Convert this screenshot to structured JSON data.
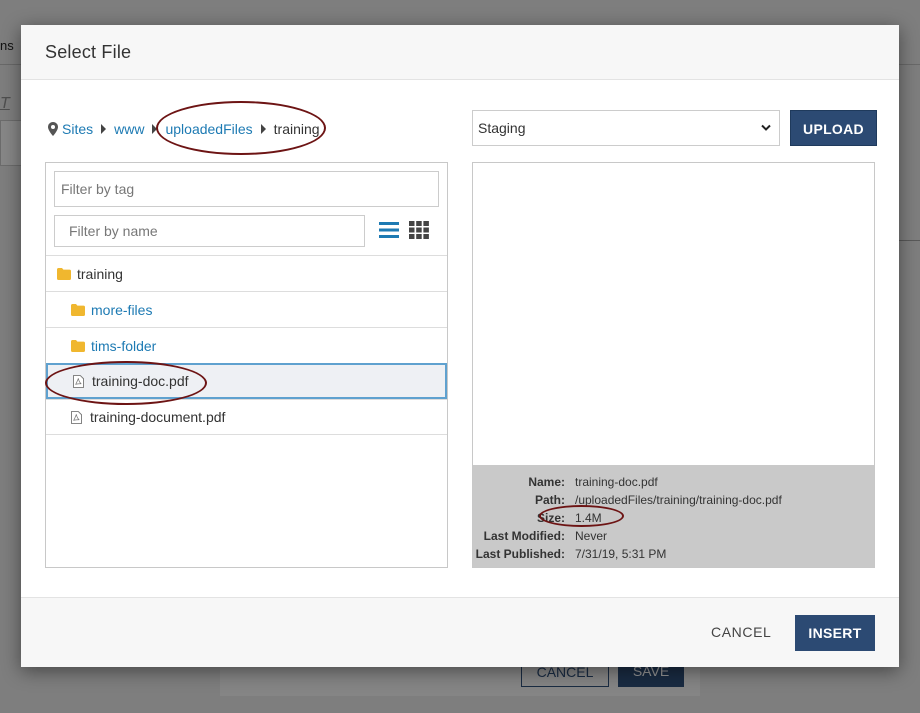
{
  "background": {
    "topbar_text": "ns",
    "italic_text": "T",
    "cancel_label": "CANCEL",
    "save_label": "SAVE"
  },
  "modal": {
    "title": "Select File"
  },
  "breadcrumb": {
    "items": [
      "Sites",
      "www",
      "uploadedFiles"
    ],
    "current": "training"
  },
  "filters": {
    "tag_placeholder": "Filter by tag",
    "name_placeholder": "Filter by name"
  },
  "files": [
    {
      "name": "training",
      "type": "folder-root"
    },
    {
      "name": "more-files",
      "type": "folder"
    },
    {
      "name": "tims-folder",
      "type": "folder"
    },
    {
      "name": "training-doc.pdf",
      "type": "file",
      "selected": true
    },
    {
      "name": "training-document.pdf",
      "type": "file"
    }
  ],
  "environment": {
    "selected": "Staging"
  },
  "upload_label": "UPLOAD",
  "details": {
    "name_label": "Name:",
    "name_value": "training-doc.pdf",
    "path_label": "Path:",
    "path_value": "/uploadedFiles/training/training-doc.pdf",
    "size_label": "Size:",
    "size_value": "1.4M",
    "modified_label": "Last Modified:",
    "modified_value": "Never",
    "published_label": "Last Published:",
    "published_value": "7/31/19, 5:31 PM"
  },
  "footer": {
    "cancel_label": "CANCEL",
    "insert_label": "INSERT"
  },
  "colors": {
    "primary": "#2c4a73",
    "link": "#1d7ab3",
    "folder": "#f0b72f",
    "annotation": "#6d1414",
    "selection_border": "#5fa1cf"
  }
}
